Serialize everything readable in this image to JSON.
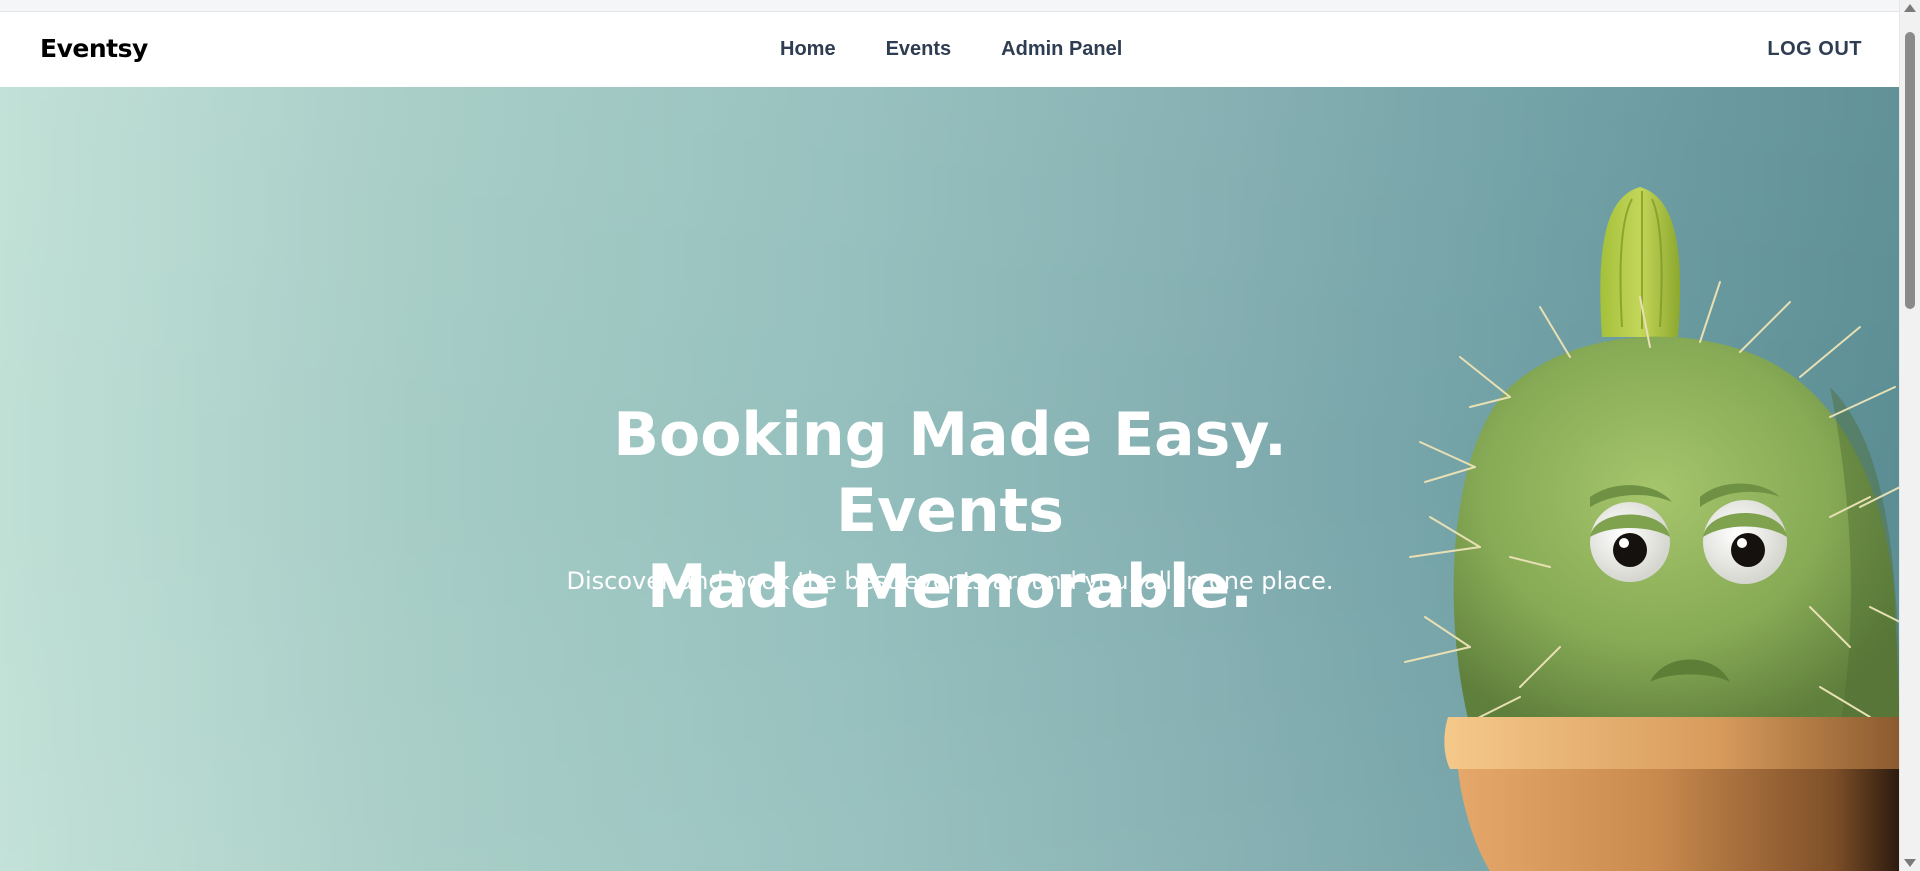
{
  "navbar": {
    "brand": "Eventsy",
    "links": [
      {
        "label": "Home"
      },
      {
        "label": "Events"
      },
      {
        "label": "Admin Panel"
      }
    ],
    "logout_label": "LOG OUT"
  },
  "hero": {
    "title_line1": "Booking Made Easy. Events",
    "title_line2": "Made Memorable.",
    "subtitle": "Discover and book the best events around you, all in one place.",
    "illustration": "cactus-in-pot-illustration"
  },
  "colors": {
    "nav_text": "#2f3d52",
    "hero_left": "#c0e0d6",
    "hero_right": "#5b8e94",
    "cactus_green": "#8fb45a",
    "pot": "#c98a4e"
  }
}
